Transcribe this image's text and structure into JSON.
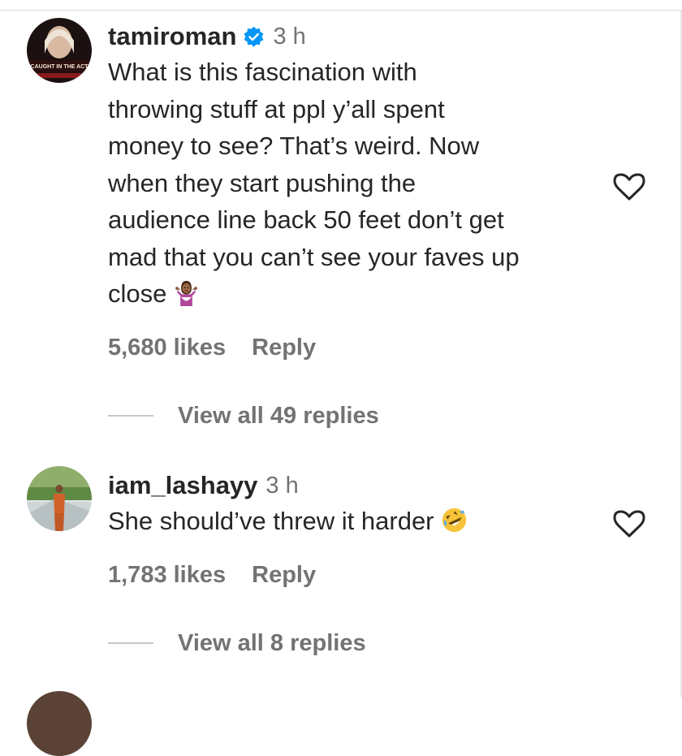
{
  "comments": [
    {
      "username": "tamiroman",
      "verified": true,
      "timestamp": "3 h",
      "avatar_text": "CAUGHT IN THE ACT",
      "text": "What is this fascination with\nthrowing stuff at ppl y’all spent\nmoney to see? That’s weird. Now\nwhen they start pushing the\naudience line back 50 feet don’t get\nmad that you can’t see your faves up\nclose",
      "emoji": "woman-shrugging-emoji",
      "likes": "5,680 likes",
      "reply_label": "Reply",
      "view_replies": "View all 49 replies",
      "like_icon": "heart-outline-icon"
    },
    {
      "username": "iam_lashayy",
      "verified": false,
      "timestamp": "3 h",
      "text": "She should’ve threw it harder",
      "emoji": "rolling-on-floor-laughing-emoji",
      "likes": "1,783 likes",
      "reply_label": "Reply",
      "view_replies": "View all 8 replies",
      "like_icon": "heart-outline-icon"
    }
  ],
  "colors": {
    "primary_text": "#262626",
    "secondary_text": "#737373",
    "verified_blue": "#0095f6"
  }
}
